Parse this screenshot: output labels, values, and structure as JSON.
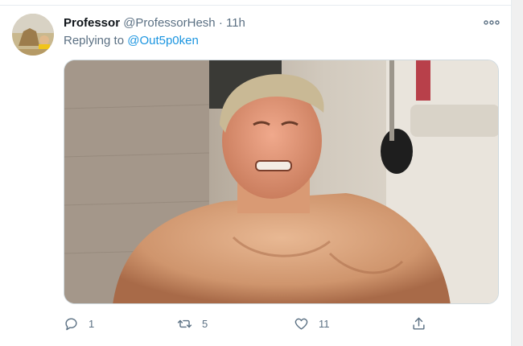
{
  "tweet": {
    "display_name": "Professor",
    "handle": "@ProfessorHesh",
    "separator": "·",
    "time": "11h",
    "replying_prefix": "Replying to ",
    "replying_to": "@Out5p0ken"
  },
  "media": {
    "icon": "photo",
    "description_hidden": true
  },
  "actions": {
    "reply_count": "1",
    "retweet_count": "5",
    "like_count": "11"
  },
  "colors": {
    "accent": "#1b95e0",
    "secondary_text": "#5b7083",
    "primary_text": "#0f1419"
  }
}
